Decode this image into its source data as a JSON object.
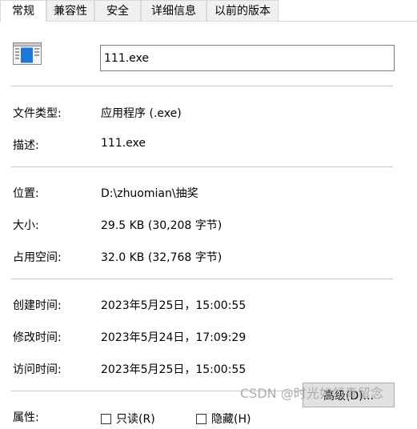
{
  "tabs": [
    {
      "label": "常规",
      "active": true
    },
    {
      "label": "兼容性",
      "active": false
    },
    {
      "label": "安全",
      "active": false
    },
    {
      "label": "详细信息",
      "active": false
    },
    {
      "label": "以前的版本",
      "active": false
    }
  ],
  "file": {
    "name": "111.exe",
    "icon": "application-window-icon"
  },
  "details": {
    "type_label": "文件类型:",
    "type_value": "应用程序 (.exe)",
    "desc_label": "描述:",
    "desc_value": "111.exe",
    "location_label": "位置:",
    "location_value": "D:\\zhuomian\\抽奖",
    "size_label": "大小:",
    "size_value": "29.5 KB (30,208 字节)",
    "disk_size_label": "占用空间:",
    "disk_size_value": "32.0 KB (32,768 字节)",
    "created_label": "创建时间:",
    "created_value": "2023年5月25日，15:00:55",
    "modified_label": "修改时间:",
    "modified_value": "2023年5月24日，17:09:29",
    "accessed_label": "访问时间:",
    "accessed_value": "2023年5月25日，15:00:55"
  },
  "attributes": {
    "label": "属性:",
    "readonly_label": "只读(R)",
    "hidden_label": "隐藏(H)",
    "advanced_button": "高级(D)...",
    "readonly_checked": false,
    "hidden_checked": false
  },
  "watermark": "CSDN @时光如领青留念",
  "colors": {
    "icon_blue": "#1e78d7",
    "separator": "#c8c8c8",
    "tab_border": "#d9d9d9"
  }
}
